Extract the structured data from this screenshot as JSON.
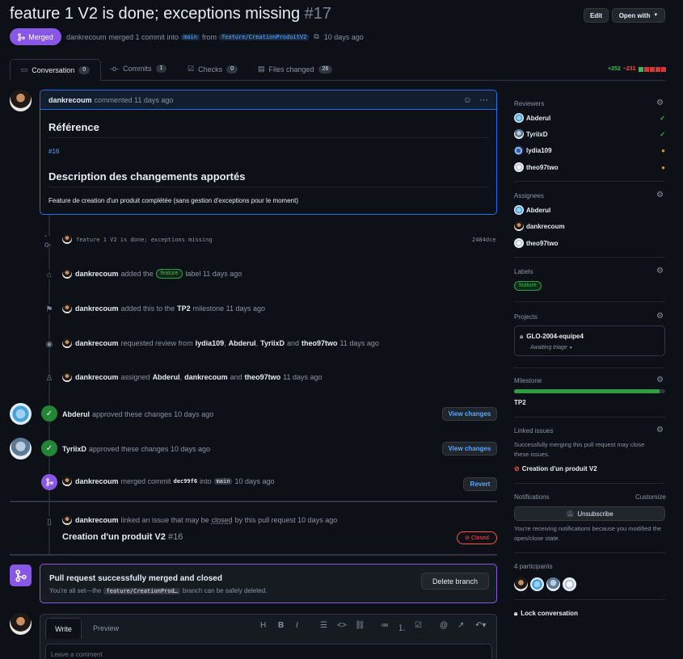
{
  "header": {
    "title": "feature 1 V2 is done; exceptions missing",
    "number": "#17",
    "edit_label": "Edit",
    "open_with_label": "Open with",
    "state_label": "Merged",
    "author": "dankrecoum",
    "merge_text": "merged 1 commit into",
    "base_branch": "main",
    "from_text": "from",
    "head_branch": "feature/CreationProduitV2",
    "time": "10 days ago"
  },
  "tabs": [
    {
      "label": "Conversation",
      "count": "0"
    },
    {
      "label": "Commits",
      "count": "1"
    },
    {
      "label": "Checks",
      "count": "0"
    },
    {
      "label": "Files changed",
      "count": "26"
    }
  ],
  "diffstat": {
    "additions": "+252",
    "deletions": "−231"
  },
  "comment": {
    "author": "dankrecoum",
    "meta": "commented 11 days ago",
    "h1": "Référence",
    "ref_link": "#16",
    "h2": "Description des changements apportés",
    "body": "Feature de creation d'un produit complétée (sans gestion d'exceptions pour le moment)"
  },
  "timeline": {
    "commit": {
      "message": "feature 1 V2 is done; exceptions missing",
      "sha": "2484dce"
    },
    "label_event": {
      "author": "dankrecoum",
      "pre": "added the",
      "label": "feature",
      "post": "label 11 days ago"
    },
    "milestone_event": {
      "author": "dankrecoum",
      "pre": "added this to the",
      "milestone": "TP2",
      "post": "milestone 11 days ago"
    },
    "review_request": {
      "author": "dankrecoum",
      "pre": "requested review from",
      "r1": "lydia109",
      "r2": "Abderul",
      "r3": "TyriixD",
      "and": "and",
      "r4": "theo97two",
      "post": "11 days ago"
    },
    "assign_event": {
      "author": "dankrecoum",
      "pre": "assigned",
      "a1": "Abderul",
      "a2": "dankrecoum",
      "and": "and",
      "a3": "theo97two",
      "post": "11 days ago"
    },
    "approve1": {
      "author": "Abderul",
      "text": "approved these changes 10 days ago",
      "button": "View changes"
    },
    "approve2": {
      "author": "TyriixD",
      "text": "approved these changes 10 days ago",
      "button": "View changes"
    },
    "merge_event": {
      "author": "dankrecoum",
      "pre": "merged commit",
      "sha": "dec99f6",
      "into": "into",
      "branch": "main",
      "post": "10 days ago",
      "button": "Revert"
    },
    "link_event": {
      "author": "dankrecoum",
      "pre": "linked an issue that may be",
      "closed": "closed",
      "post": "by this pull request 10 days ago",
      "issue_title": "Creation d'un produit V2",
      "issue_number": "#16",
      "badge": "Closed"
    }
  },
  "merged_box": {
    "title": "Pull request successfully merged and closed",
    "pre": "You're all set—the",
    "branch": "feature/CreationProd…",
    "post": "branch can be safely deleted.",
    "delete_button": "Delete branch"
  },
  "composer": {
    "tab_write": "Write",
    "tab_preview": "Preview",
    "placeholder": "Leave a comment"
  },
  "sidebar": {
    "reviewers_heading": "Reviewers",
    "reviewers": [
      {
        "name": "Abderul",
        "status": "approved"
      },
      {
        "name": "TyriixD",
        "status": "approved"
      },
      {
        "name": "lydia109",
        "status": "pending"
      },
      {
        "name": "theo97two",
        "status": "pending"
      }
    ],
    "assignees_heading": "Assignees",
    "assignees": [
      "Abderul",
      "dankrecoum",
      "theo97two"
    ],
    "labels_heading": "Labels",
    "label": "feature",
    "projects_heading": "Projects",
    "project_name": "GLO-2004-equipe4",
    "project_status": "Awaiting triage",
    "milestone_heading": "Milestone",
    "milestone_name": "TP2",
    "milestone_progress": 0.96,
    "linked_heading": "Linked issues",
    "linked_text": "Successfully merging this pull request may close these issues.",
    "linked_issue": "Creation d'un produit V2",
    "notifications_heading": "Notifications",
    "customize": "Customize",
    "unsubscribe": "Unsubscribe",
    "notif_text": "You're receiving notifications because you modified the open/close state.",
    "participants_heading": "4 participants",
    "lock": "Lock conversation"
  },
  "colors": {
    "accent": "#2f81f7",
    "merged": "#8957e5",
    "success": "#3fb950",
    "danger": "#f85149",
    "pending": "#d29922"
  }
}
